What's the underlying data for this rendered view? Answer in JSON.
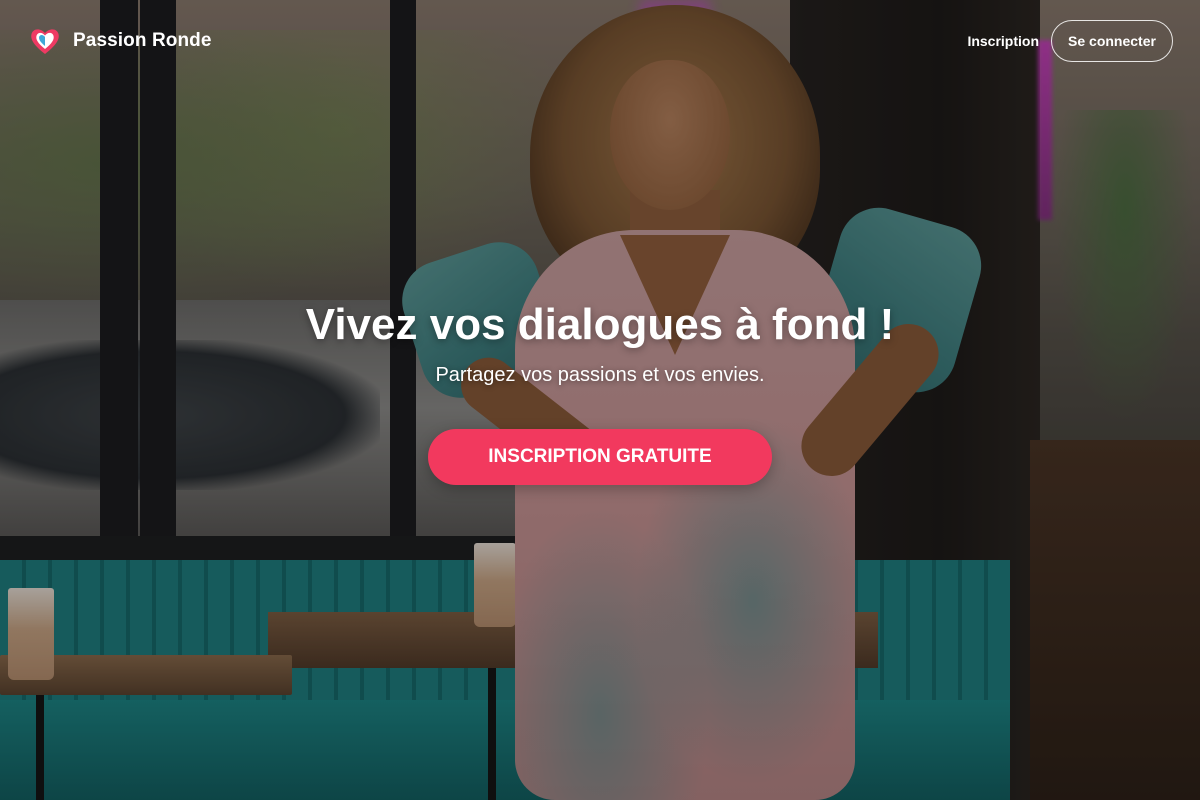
{
  "brand": {
    "name": "Passion Ronde",
    "logo_icon": "heart-icon",
    "logo_colors": [
      "#ee3a63",
      "#3fa8d8"
    ]
  },
  "nav": {
    "signup_label": "Inscription",
    "login_label": "Se connecter"
  },
  "hero": {
    "title": "Vivez vos dialogues à fond !",
    "subtitle": "Partagez vos passions et vos envies.",
    "cta_label": "INSCRIPTION GRATUITE"
  },
  "colors": {
    "accent": "#f2395e",
    "text": "#ffffff"
  }
}
